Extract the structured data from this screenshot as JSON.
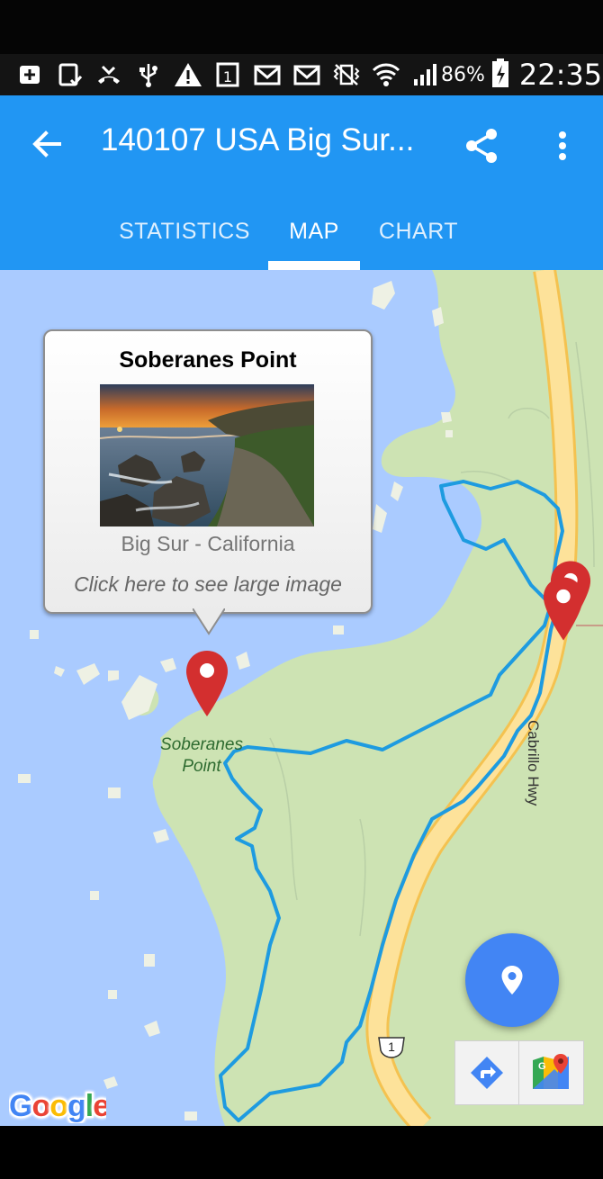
{
  "status_bar": {
    "icons": [
      "add-box-icon",
      "clipboard-check-icon",
      "missed-call-icon",
      "usb-icon",
      "warning-icon",
      "sim-icon",
      "gmail-icon",
      "gmail-icon",
      "vibrate-icon",
      "wifi-icon",
      "signal-icon",
      "battery-charging-icon"
    ],
    "battery_percent": "86%",
    "time": "22:35"
  },
  "app_bar": {
    "title": "140107 USA Big Sur...",
    "back_icon": "arrow-back-icon",
    "share_icon": "share-icon",
    "more_icon": "more-vert-icon",
    "color": "#2196F3"
  },
  "tabs": [
    {
      "label": "STATISTICS",
      "selected": false
    },
    {
      "label": "MAP",
      "selected": true
    },
    {
      "label": "CHART",
      "selected": false
    }
  ],
  "map": {
    "road_label": "Cabrillo Hwy",
    "route_shield": "1",
    "poi_label_line1": "Soberanes",
    "poi_label_line2": "Point",
    "track_color": "#1e9be0",
    "water_color": "#aacbff",
    "land_color": "#cde3b3",
    "road_color": "#fcd96a",
    "marker_color": "#d32f2f",
    "attribution": "Google"
  },
  "info_window": {
    "title": "Soberanes Point",
    "subtitle": "Big Sur - California",
    "link_text": "Click here to see large image"
  },
  "fab": {
    "icon": "place-icon",
    "color": "#4285F4"
  },
  "map_toolbar": [
    {
      "icon": "directions-icon"
    },
    {
      "icon": "google-maps-icon"
    }
  ]
}
